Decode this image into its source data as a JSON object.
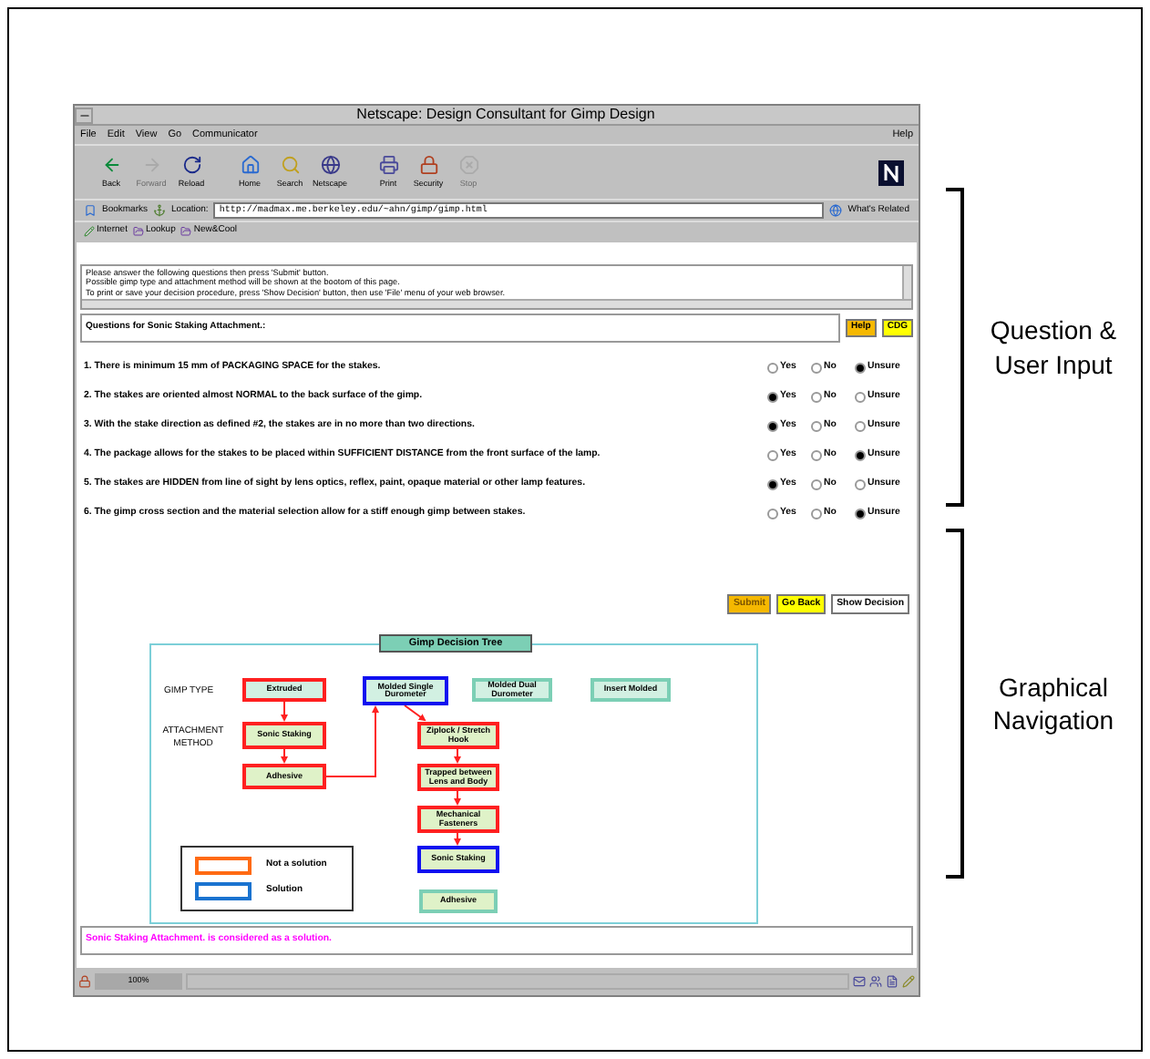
{
  "window": {
    "title": "Netscape: Design Consultant for Gimp Design"
  },
  "menu": [
    "File",
    "Edit",
    "View",
    "Go",
    "Communicator"
  ],
  "help_menu": "Help",
  "toolbar": [
    {
      "label": "Back",
      "disabled": false
    },
    {
      "label": "Forward",
      "disabled": true
    },
    {
      "label": "Reload",
      "disabled": false
    },
    {
      "label": "Home",
      "disabled": false
    },
    {
      "label": "Search",
      "disabled": false
    },
    {
      "label": "Netscape",
      "disabled": false
    },
    {
      "label": "Print",
      "disabled": false
    },
    {
      "label": "Security",
      "disabled": false
    },
    {
      "label": "Stop",
      "disabled": true
    }
  ],
  "location_bar": {
    "bookmarks": "Bookmarks",
    "label": "Location:",
    "url": "http://madmax.me.berkeley.edu/~ahn/gimp/gimp.html",
    "related": "What's Related"
  },
  "personal_toolbar": [
    "Internet",
    "Lookup",
    "New&Cool"
  ],
  "instructions": [
    "Please answer the following questions then press 'Submit' button.",
    "Possible gimp type and attachment method will be shown at the bootom of this page.",
    "To print or save your decision procedure, press 'Show Decision' button, then use 'File' menu of your web browser."
  ],
  "section_title": "Questions for Sonic Staking Attachment.:",
  "header_buttons": [
    "Help",
    "CDG"
  ],
  "questions": [
    {
      "text": "1. There is minimum 15 mm of PACKAGING SPACE for the stakes.",
      "options": [
        {
          "label": "Yes",
          "selected": false
        },
        {
          "label": "No",
          "selected": false
        },
        {
          "label": "Unsure",
          "selected": true
        }
      ]
    },
    {
      "text": "2. The stakes are oriented almost NORMAL to the back surface of the gimp.",
      "options": [
        {
          "label": "Yes",
          "selected": true
        },
        {
          "label": "No",
          "selected": false
        },
        {
          "label": "Unsure",
          "selected": false
        }
      ]
    },
    {
      "text": "3. With the stake direction as defined #2, the stakes are in no more than two directions.",
      "options": [
        {
          "label": "Yes",
          "selected": true
        },
        {
          "label": "No",
          "selected": false
        },
        {
          "label": "Unsure",
          "selected": false
        }
      ]
    },
    {
      "text": "4. The package allows for the stakes to be placed within SUFFICIENT DISTANCE from the front surface of the lamp.",
      "options": [
        {
          "label": "Yes",
          "selected": false
        },
        {
          "label": "No",
          "selected": false
        },
        {
          "label": "Unsure",
          "selected": true
        }
      ]
    },
    {
      "text": "5. The stakes are HIDDEN from line of sight by lens optics, reflex, paint, opaque material or other lamp features.",
      "options": [
        {
          "label": "Yes",
          "selected": true
        },
        {
          "label": "No",
          "selected": false
        },
        {
          "label": "Unsure",
          "selected": false
        }
      ]
    },
    {
      "text": "6. The gimp cross section and the material selection allow for a stiff enough gimp between stakes.",
      "options": [
        {
          "label": "Yes",
          "selected": false
        },
        {
          "label": "No",
          "selected": false
        },
        {
          "label": "Unsure",
          "selected": true
        }
      ]
    }
  ],
  "action_buttons": [
    {
      "label": "Submit",
      "disabled": true,
      "color": "#f5b800"
    },
    {
      "label": "Go Back",
      "disabled": false,
      "color": "#ffff00"
    },
    {
      "label": "Show Decision",
      "disabled": false,
      "color": "#ffffff"
    }
  ],
  "decision_tree": {
    "title": "Gimp Decision Tree",
    "row_labels": [
      "GIMP TYPE",
      "ATTACHMENT METHOD"
    ],
    "gimp_types": [
      {
        "label": "Extruded",
        "kind": "rejected"
      },
      {
        "label": "Molded Single Durometer",
        "kind": "solution"
      },
      {
        "label": "Molded Dual Durometer",
        "kind": "open"
      },
      {
        "label": "Insert Molded",
        "kind": "open"
      }
    ],
    "attachment_methods": [
      {
        "label": "Sonic Staking",
        "kind": "rejected"
      },
      {
        "label": "Adhesive",
        "kind": "rejected"
      },
      {
        "label": "Ziplock / Stretch Hook",
        "kind": "rejected"
      },
      {
        "label": "Trapped between Lens and Body",
        "kind": "rejected"
      },
      {
        "label": "Mechanical Fasteners",
        "kind": "rejected"
      },
      {
        "label": "Sonic Staking",
        "kind": "solution"
      },
      {
        "label": "Adhesive",
        "kind": "open"
      }
    ],
    "legend": [
      {
        "label": "Not a solution",
        "color": "#ff6a13"
      },
      {
        "label": "Solution",
        "color": "#1a73d0"
      }
    ]
  },
  "message": "Sonic Staking Attachment. is considered as a solution.",
  "status_bar": {
    "zoom": "100%"
  },
  "annotations": [
    "Question & User Input",
    "Graphical Navigation"
  ]
}
